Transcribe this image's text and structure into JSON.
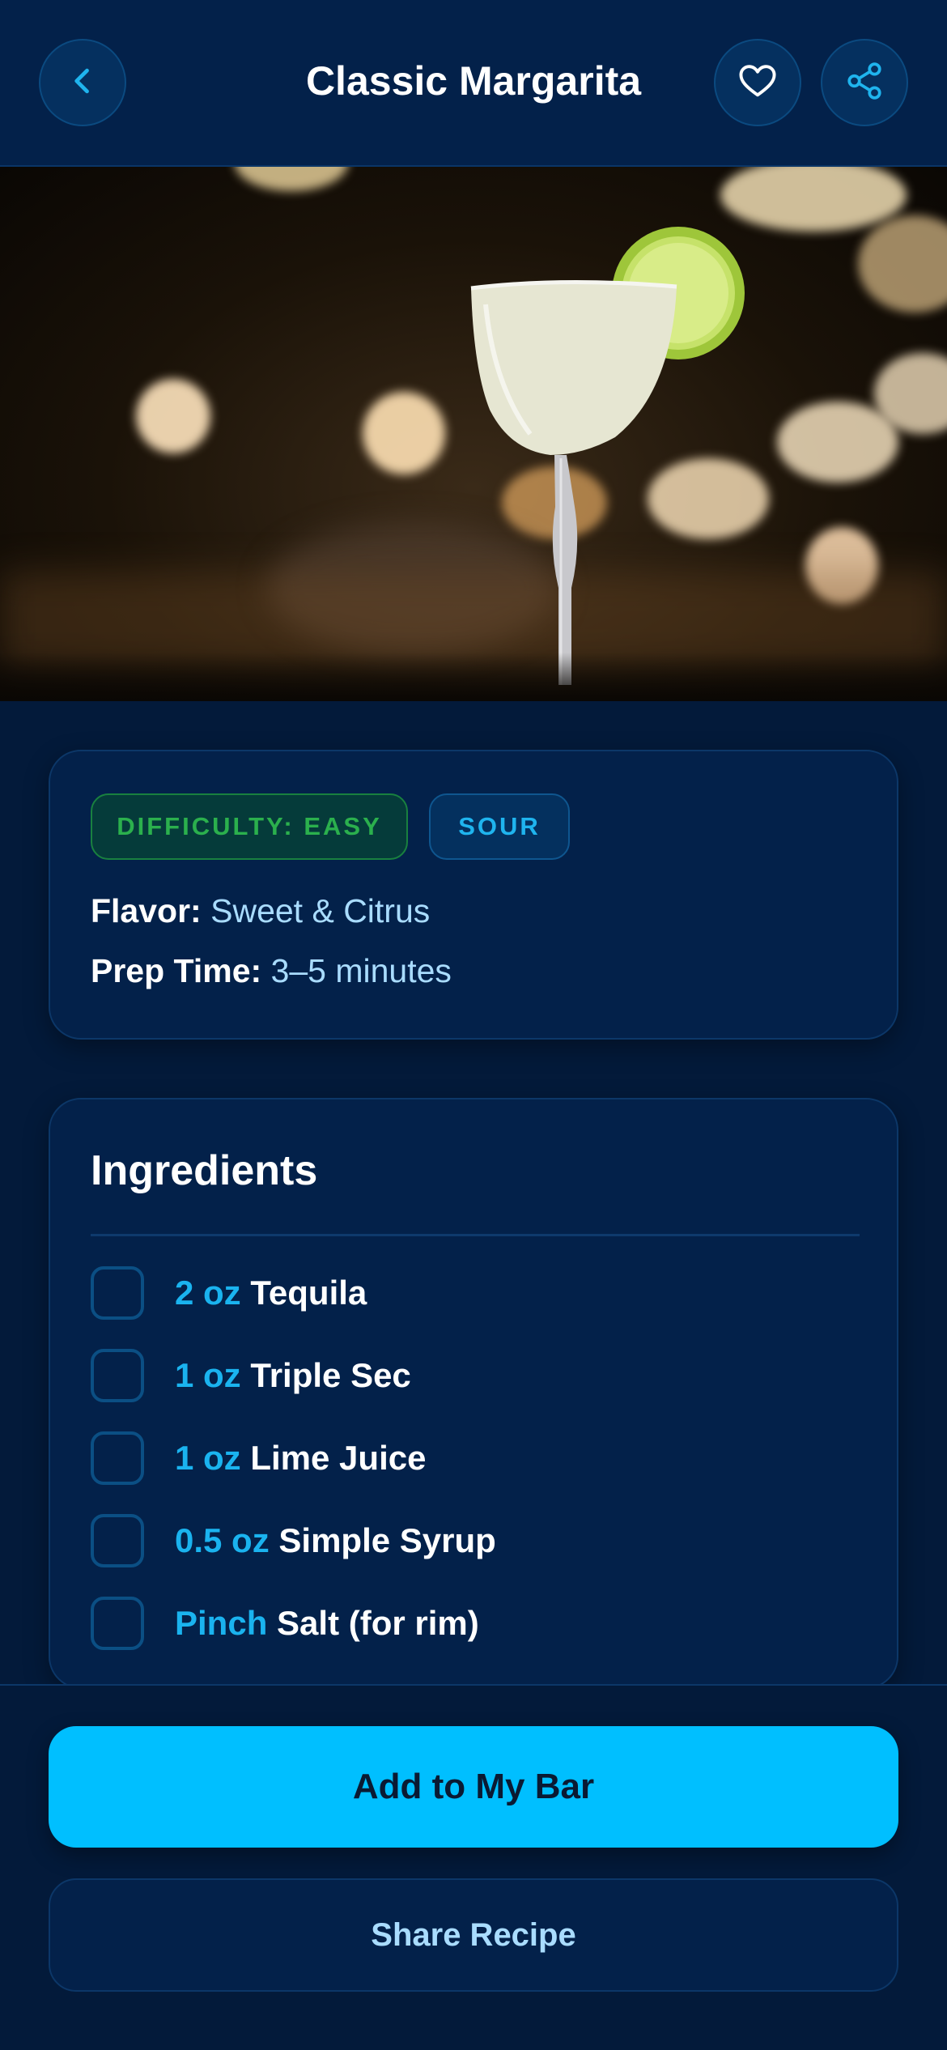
{
  "header": {
    "title": "Classic Margarita",
    "back_icon": "chevron-left-icon",
    "favorite_icon": "heart-icon",
    "share_icon": "share-icon"
  },
  "hero": {
    "image": "margarita-photo"
  },
  "info": {
    "difficulty_badge": "DIFFICULTY: EASY",
    "category_badge": "SOUR",
    "flavor_label": "Flavor:",
    "flavor_value": "Sweet & Citrus",
    "prep_label": "Prep Time:",
    "prep_value": "3–5 minutes"
  },
  "ingredients": {
    "title": "Ingredients",
    "items": [
      {
        "qty": "2 oz",
        "name": "Tequila"
      },
      {
        "qty": "1 oz",
        "name": "Triple Sec"
      },
      {
        "qty": "1 oz",
        "name": "Lime Juice"
      },
      {
        "qty": "0.5 oz",
        "name": "Simple Syrup"
      },
      {
        "qty": "Pinch",
        "name": "Salt (for rim)"
      }
    ]
  },
  "actions": {
    "primary": "Add to My Bar",
    "secondary": "Share Recipe"
  },
  "colors": {
    "background": "#031a3a",
    "accent": "#00bfff",
    "easy_green": "#2bb04d"
  }
}
